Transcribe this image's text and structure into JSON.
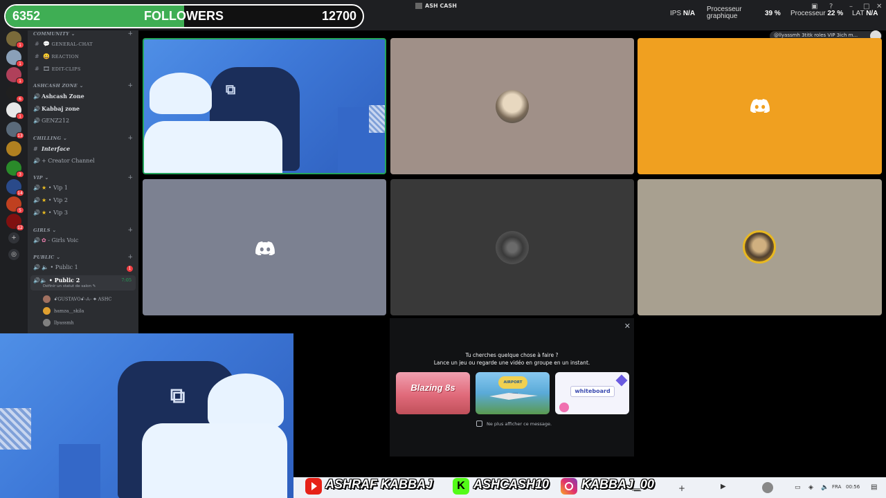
{
  "titlebar": {
    "followers": {
      "current": "6352",
      "label": "FOLLOWERS",
      "goal": "12700",
      "progress": 0.5
    },
    "app_title": "ASH CASH",
    "stats": {
      "ips_label": "IPS",
      "ips_value": "N/A",
      "gpu_label_line1": "Processeur",
      "gpu_label_line2": "graphique",
      "gpu_value": "39 %",
      "cpu_label": "Processeur",
      "cpu_value": "22 %",
      "lat_label": "LAT",
      "lat_value": "N/A"
    }
  },
  "rail": {
    "servers": [
      {
        "color": "#7a6a3a",
        "badge": "1"
      },
      {
        "color": "#8aa0b8",
        "badge": "1"
      },
      {
        "color": "#b0405a",
        "badge": "1"
      },
      {
        "color": "#202020",
        "badge": "6"
      },
      {
        "color": "#e8e8e8",
        "badge": "1"
      },
      {
        "color": "#5a6a7a",
        "badge": "13"
      },
      {
        "color": "#b08020",
        "badge": ""
      },
      {
        "color": "#2a8a2a",
        "badge": "3"
      },
      {
        "color": "#2a4a8a",
        "badge": "14"
      },
      {
        "color": "#c04020",
        "badge": "5"
      },
      {
        "color": "#801010",
        "badge": "12"
      }
    ],
    "add_icon": "plus-icon",
    "discover_icon": "compass-icon"
  },
  "channels": {
    "community": {
      "label": "COMMUNITY",
      "items": [
        {
          "icon": "text-channel-icon",
          "label": "GENERAL-CHAT",
          "emoji": "💬"
        },
        {
          "icon": "text-channel-icon",
          "label": "REACTION",
          "emoji": "😀"
        },
        {
          "icon": "text-channel-icon",
          "label": "EDIT-CLIPS",
          "emoji": "🎞"
        }
      ]
    },
    "ashcash_zone": {
      "label": "ASHCASH ZONE",
      "items": [
        {
          "label": "Ashcash Zone"
        },
        {
          "label": "Kabbaj zone"
        },
        {
          "label": "GENZ212"
        }
      ]
    },
    "chilling": {
      "label": "CHILLING",
      "items": [
        {
          "label": "Interface"
        },
        {
          "label": "Creator Channel"
        }
      ]
    },
    "vip": {
      "label": "VIP",
      "items": [
        {
          "label": "Vip 1"
        },
        {
          "label": "Vip 2"
        },
        {
          "label": "Vip 3"
        }
      ]
    },
    "girls": {
      "label": "GIRLS",
      "items": [
        {
          "label": "Girls Voic"
        }
      ]
    },
    "public": {
      "label": "PUBLIC",
      "items": [
        {
          "label": "Public 1",
          "badge": "1"
        },
        {
          "label": "Public 2",
          "timer": "7:05",
          "status": "Définir un statut de salon"
        }
      ],
      "voice_users": [
        {
          "name": "ꗃGUSTAVOꗃ-ᗋ- ✦ ASHC",
          "color": "#a07060"
        },
        {
          "name": "hamza__skila",
          "color": "#e0a030"
        },
        {
          "name": "llyassmh",
          "color": "#808080"
        }
      ]
    }
  },
  "stage": {
    "toast": "@llyassmh 3titk roles VIP 3ich m...",
    "tiles": [
      {
        "kind": "camera",
        "bg": "#4a8ae6"
      },
      {
        "kind": "avatar",
        "bg": "#a09088",
        "avatar": "#c8b8a0"
      },
      {
        "kind": "logo",
        "bg": "#f0a020"
      },
      {
        "kind": "logo",
        "bg": "#7c8191"
      },
      {
        "kind": "avatar",
        "bg": "#393939",
        "avatar": "#505050"
      },
      {
        "kind": "avatar",
        "bg": "#a8a090",
        "avatar": "#c89020"
      }
    ]
  },
  "activity": {
    "line1": "Tu cherches quelque chose à faire ?",
    "line2": "Lance un jeu ou regarde une vidéo en groupe en un instant.",
    "cards": [
      {
        "title": "Blazing 8s",
        "bg": "#e07080"
      },
      {
        "title": "AIRPORT CITY",
        "bg": "#50a0d0"
      },
      {
        "title": "whiteboard",
        "bg": "#f4f4fc"
      }
    ],
    "dont_show": "Ne plus afficher ce message."
  },
  "overlay": {
    "youtube": "ASHRAF KABBAJ",
    "kick": "ASHCASH10",
    "instagram": "KABBAJ_00"
  },
  "taskbar": {
    "lang": "FRA",
    "time": "00:56"
  }
}
